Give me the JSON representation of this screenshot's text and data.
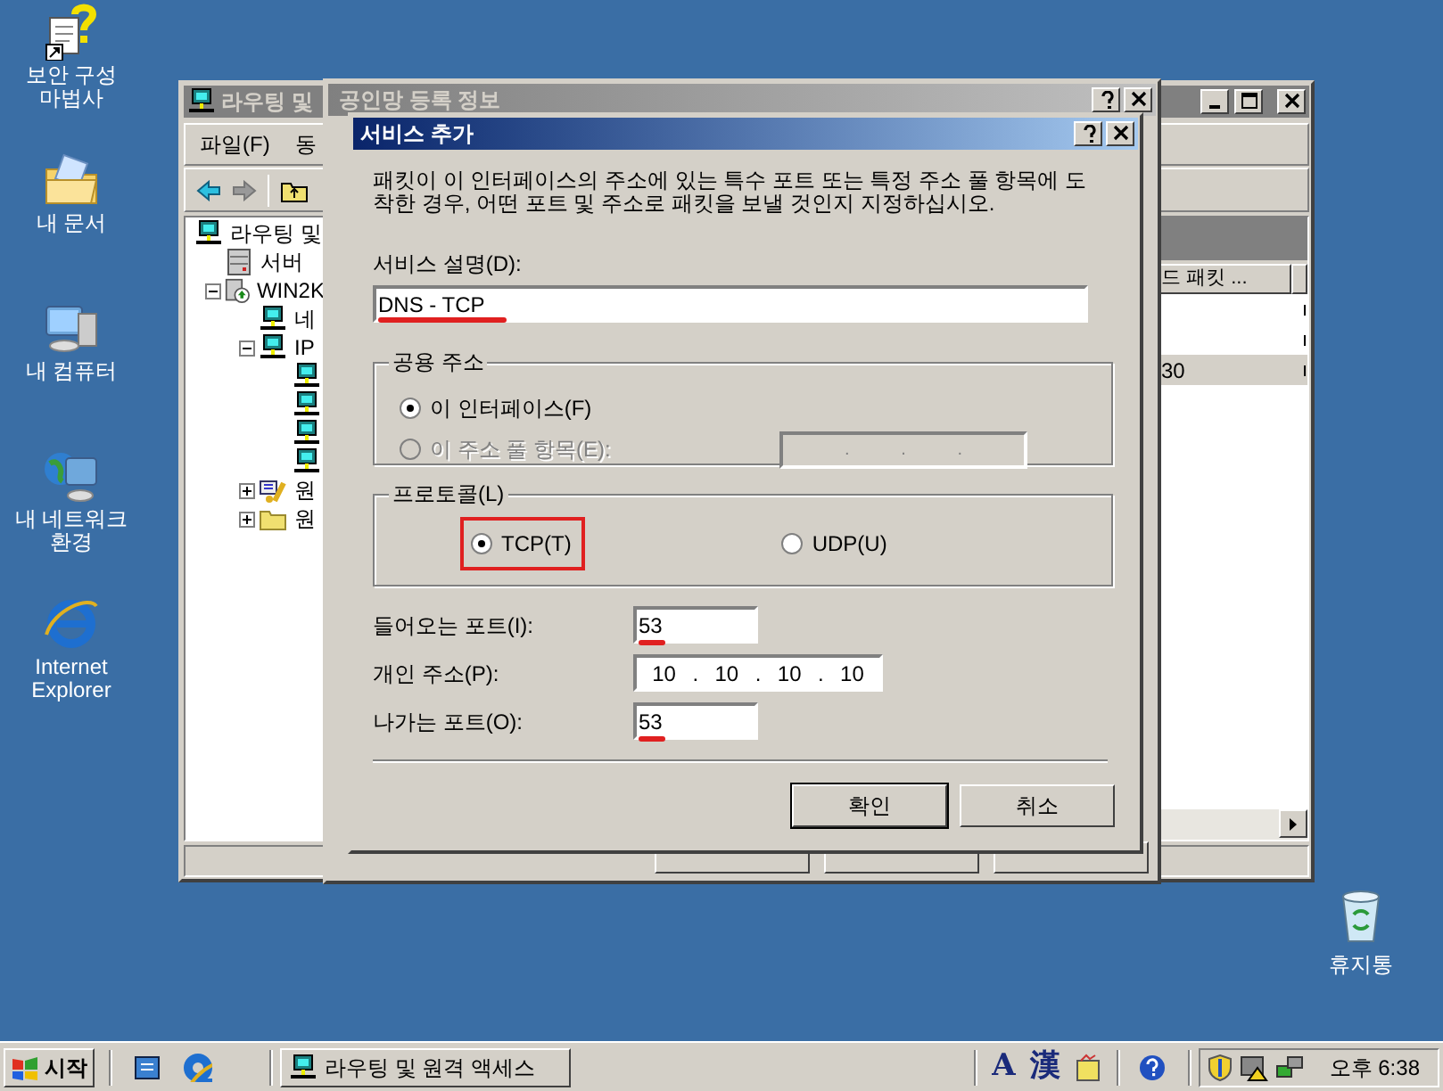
{
  "desktop_icons": [
    {
      "label": "보안 구성 마법사",
      "kind": "wizard"
    },
    {
      "label": "내 문서",
      "kind": "documents"
    },
    {
      "label": "내 컴퓨터",
      "kind": "computer"
    },
    {
      "label": "내 네트워크 환경",
      "kind": "network"
    },
    {
      "label": "Internet Explorer",
      "kind": "browser"
    }
  ],
  "recycle_bin": {
    "label": "휴지통"
  },
  "main_window": {
    "title": "라우팅 및",
    "menu": [
      "파일(F)",
      "동"
    ],
    "tree": [
      {
        "label": "라우팅 및",
        "kind": "router",
        "children": [
          {
            "label": "서버",
            "kind": "server"
          },
          {
            "label": "WIN2K",
            "kind": "host",
            "expanded": true,
            "children": [
              {
                "label": "네",
                "kind": "router"
              },
              {
                "label": "IP",
                "kind": "router",
                "expanded": true,
                "children": [
                  {
                    "kind": "router"
                  },
                  {
                    "kind": "router"
                  },
                  {
                    "kind": "router"
                  },
                  {
                    "kind": "router"
                  }
                ]
              },
              {
                "label": "원",
                "kind": "policy",
                "expanded": false
              },
              {
                "label": "원",
                "kind": "folder",
                "expanded": false
              }
            ]
          }
        ]
      }
    ],
    "list": {
      "column": "드 패킷 ...",
      "rows": [
        {
          "selected": false
        },
        {
          "selected": false
        },
        {
          "value": "30",
          "selected": true
        }
      ]
    }
  },
  "properties_dialog": {
    "title": "공인망 등록 정보"
  },
  "dialog": {
    "title": "서비스 추가",
    "description": "패킷이 이 인터페이스의 주소에 있는 특수 포트 또는 특정 주소 풀 항목에 도착한 경우, 어떤 포트 및 주소로 패킷을 보낼 것인지 지정하십시오.",
    "service_label": "서비스 설명(D):",
    "service_value": "DNS - TCP",
    "service_marked": true,
    "public_address": {
      "legend": "공용 주소",
      "options": [
        {
          "label": "이 인터페이스(F)",
          "selected": true,
          "disabled": false
        },
        {
          "label": "이 주소 풀 항목(E):",
          "selected": false,
          "disabled": true,
          "ip_separator": "."
        }
      ]
    },
    "protocol": {
      "legend": "프로토콜(L)",
      "options": [
        {
          "label": "TCP(T)",
          "selected": true,
          "highlighted": true
        },
        {
          "label": "UDP(U)",
          "selected": false,
          "highlighted": false
        }
      ]
    },
    "fields": [
      {
        "label": "들어오는 포트(I):",
        "kind": "port",
        "value": "53",
        "marked": true
      },
      {
        "label": "개인 주소(P):",
        "kind": "ip",
        "octets": [
          "10",
          "10",
          "10",
          "10"
        ],
        "separator": "."
      },
      {
        "label": "나가는 포트(O):",
        "kind": "port",
        "value": "53",
        "marked": true
      }
    ],
    "buttons": [
      {
        "label": "확인",
        "default": true
      },
      {
        "label": "취소",
        "default": false
      }
    ]
  },
  "taskbar": {
    "start": "시작",
    "tasks": [
      {
        "label": "라우팅 및 원격 액세스",
        "selected": false
      }
    ],
    "ime": [
      "A",
      "漢"
    ],
    "clock": "오후 6:38"
  }
}
